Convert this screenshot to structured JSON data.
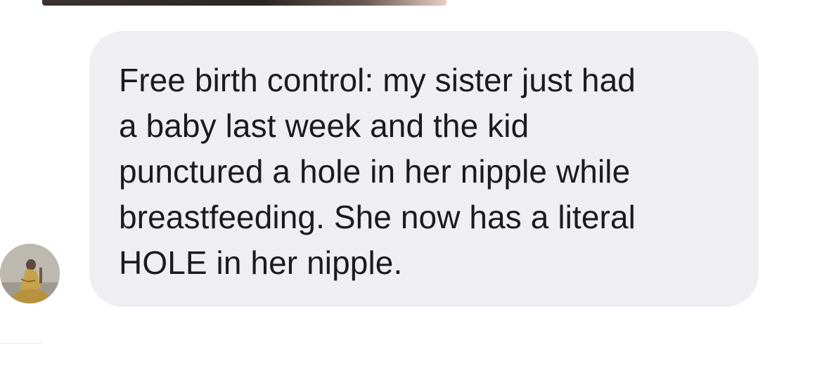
{
  "conversation": {
    "message": {
      "text": "Free birth control: my sister just had\na baby last week and the kid\npunctured a hole in her nipple while\nbreastfeeding. She now has a literal\nHOLE in her nipple."
    },
    "sender": {
      "avatar_icon": "profile-photo"
    }
  },
  "colors": {
    "bubble_background": "#efeef3",
    "text": "#1b1b1d",
    "page_background": "#ffffff"
  }
}
